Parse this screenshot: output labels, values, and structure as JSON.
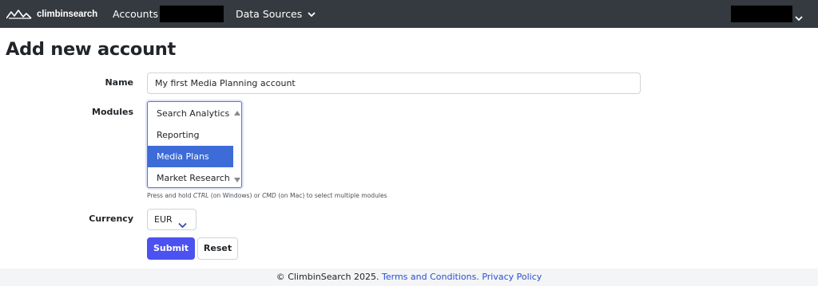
{
  "navbar": {
    "brand_name": "climbinsearch",
    "accounts_label": "Accounts",
    "data_sources_label": "Data Sources",
    "background_color": "#343a40"
  },
  "page": {
    "title": "Add new account"
  },
  "form": {
    "name_label": "Name",
    "name_value": "My first Media Planning account",
    "modules_label": "Modules",
    "modules_options": [
      "Search Analytics",
      "Reporting",
      "Media Plans",
      "Market Research"
    ],
    "modules_selected": "Media Plans",
    "help_prefix": "Press and hold ",
    "help_key1": "CTRL",
    "help_mid1": " (on Windows) or ",
    "help_key2": "CMD",
    "help_suffix": " (on Mac) to select multiple modules",
    "currency_label": "Currency",
    "currency_value": "EUR",
    "submit_label": "Submit",
    "reset_label": "Reset",
    "accent_color": "#4c52f0",
    "selected_option_color": "#3d6cd8"
  },
  "footer": {
    "copyright": "© ClimbinSearch 2025.",
    "terms_link": "Terms and Conditions.",
    "privacy_link": "Privacy Policy"
  },
  "icons": {
    "brand_logo": "mountain-peaks-icon",
    "dropdown": "chevron-down-icon"
  }
}
